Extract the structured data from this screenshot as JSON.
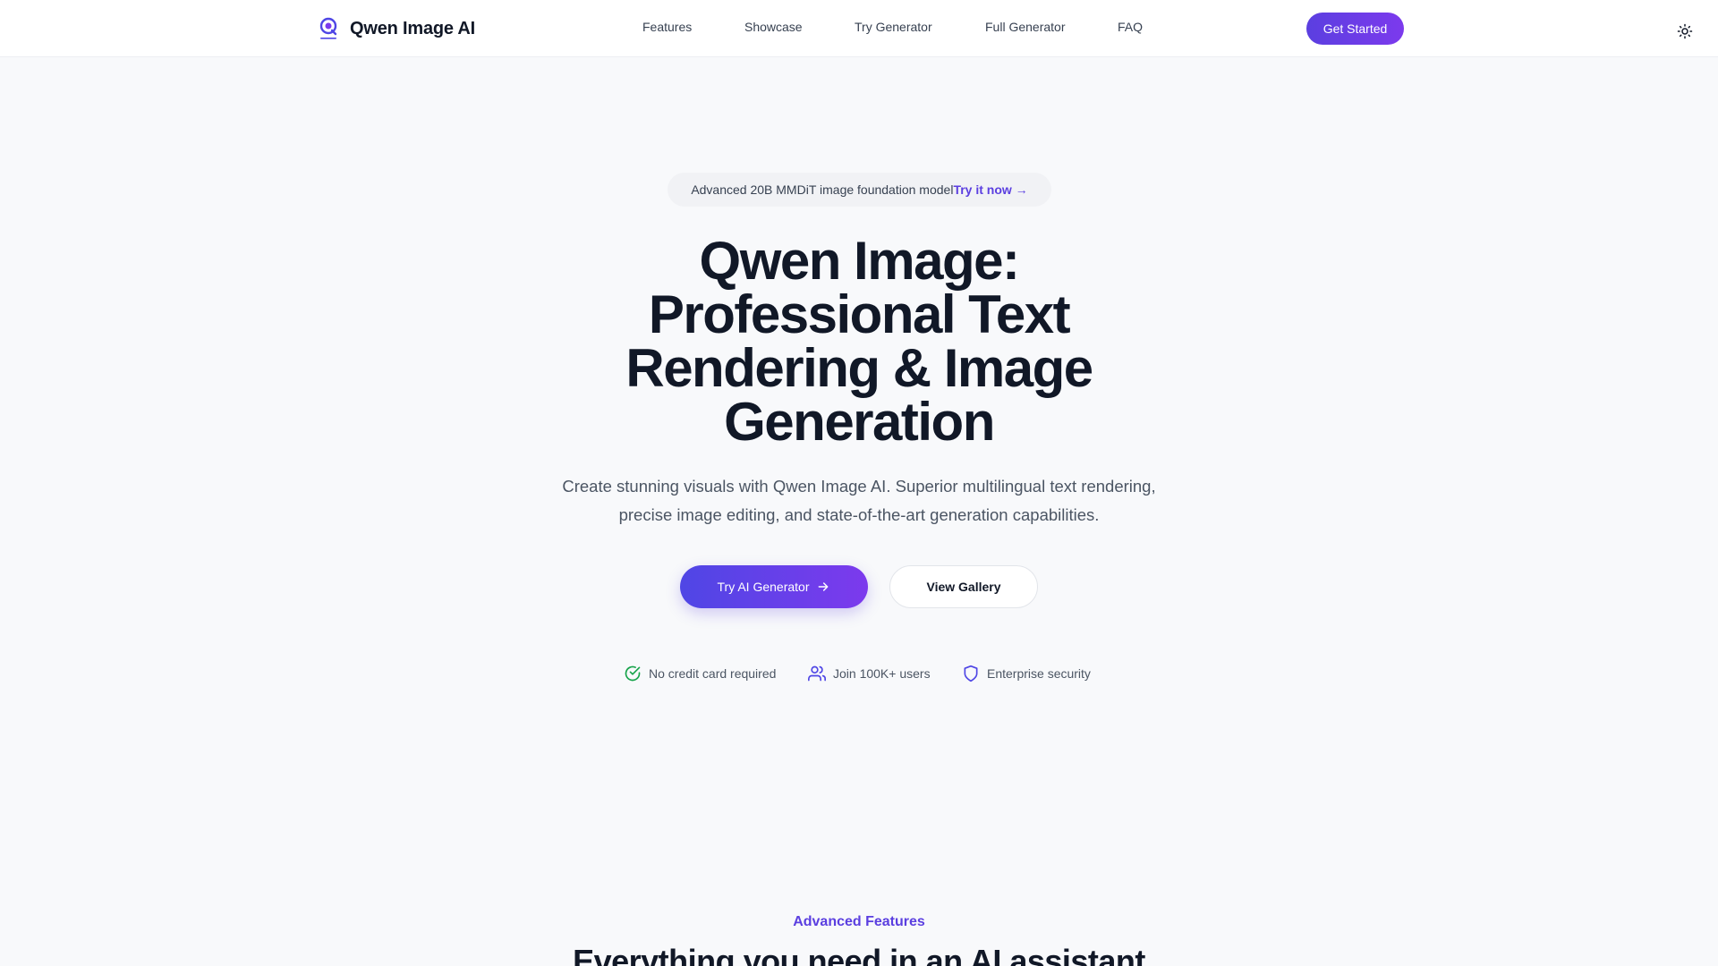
{
  "nav": {
    "brand": "Qwen Image AI",
    "links": [
      "Features",
      "Showcase",
      "Try Generator",
      "Full Generator",
      "FAQ"
    ],
    "cta": "Get Started"
  },
  "hero": {
    "badge_text": "Advanced 20B MMDiT image foundation model",
    "badge_link": "Try it now →",
    "title_lines": [
      "Qwen Image:",
      "Professional Text",
      "Rendering & Image",
      "Generation"
    ],
    "subtitle_lines": [
      "Create stunning visuals with Qwen Image AI. Superior multilingual text rendering,",
      "precise image editing, and state-of-the-art generation capabilities."
    ],
    "primary_button": "Try AI Generator",
    "secondary_button": "View Gallery",
    "trust_items": [
      {
        "label": "No credit card required",
        "icon": "check-circle-icon",
        "color": "#16a34a"
      },
      {
        "label": "Join 100K+ users",
        "icon": "users-icon",
        "color": "#4f46e5"
      },
      {
        "label": "Enterprise security",
        "icon": "shield-icon",
        "color": "#4f46e5"
      }
    ]
  },
  "features_section": {
    "eyebrow": "Advanced Features",
    "title": "Everything you need in an AI assistant"
  },
  "colors": {
    "accent": "#5b3fe0",
    "accent_end": "#7c3aed",
    "background": "#f8f9fb",
    "text_primary": "#111827",
    "text_secondary": "#4b5563"
  }
}
